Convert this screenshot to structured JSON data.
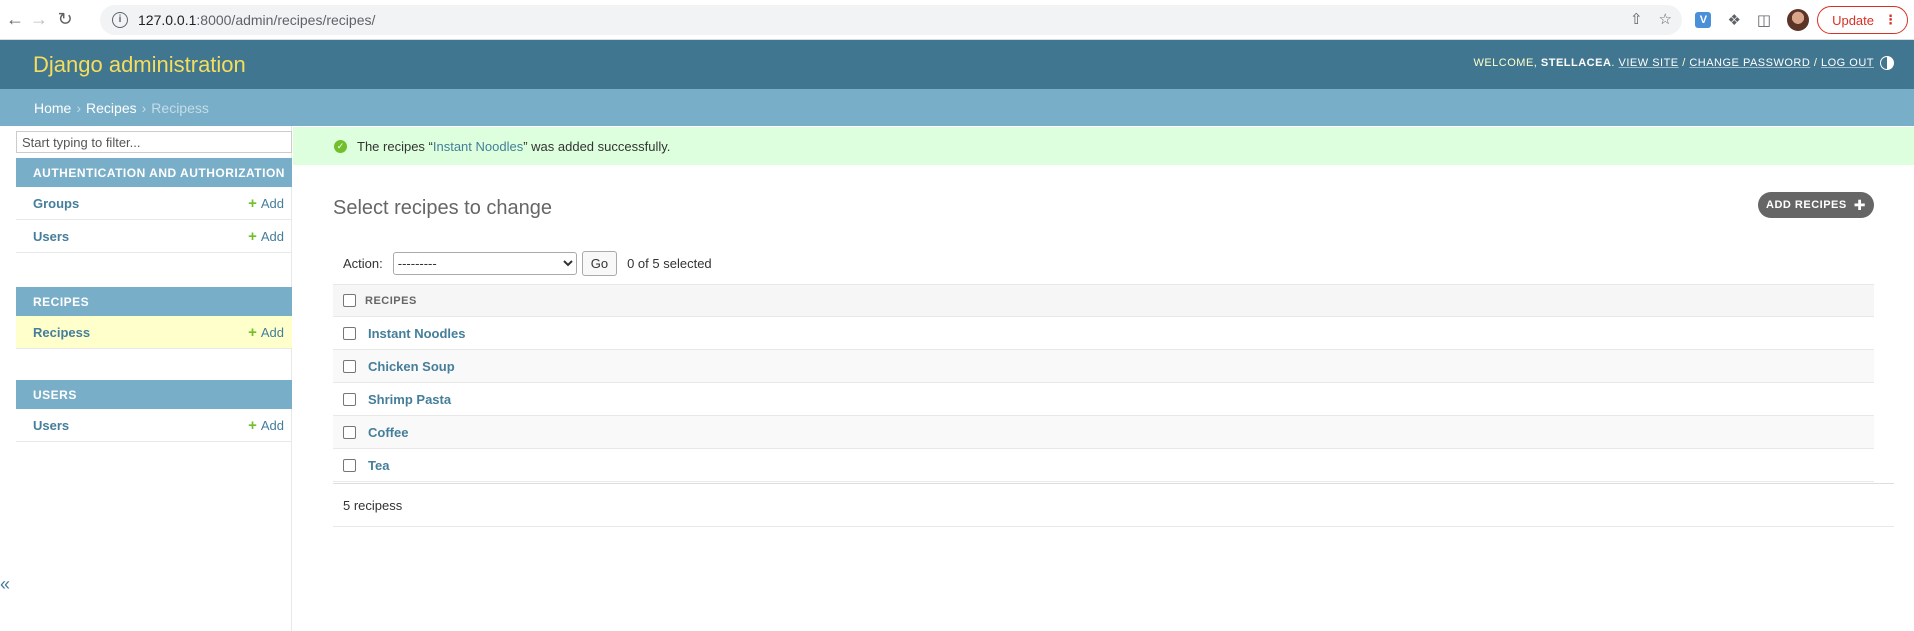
{
  "browser": {
    "url_host": "127.0.0.1",
    "url_path": ":8000/admin/recipes/recipes/",
    "update_label": "Update",
    "extension_label": "V"
  },
  "header": {
    "site_title": "Django administration",
    "welcome": "Welcome,",
    "username": "stellacea",
    "view_site": "View site",
    "change_password": "Change password",
    "log_out": "Log out"
  },
  "breadcrumbs": {
    "home": "Home",
    "app": "Recipes",
    "current": "Recipess",
    "separator": "›"
  },
  "sidebar": {
    "filter_placeholder": "Start typing to filter...",
    "add_label": "Add",
    "apps": [
      {
        "caption": "Authentication and Authorization",
        "models": [
          "Groups",
          "Users"
        ]
      },
      {
        "caption": "Recipes",
        "models": [
          "Recipess"
        ]
      },
      {
        "caption": "Users",
        "models": [
          "Users"
        ]
      }
    ],
    "collapse_glyph": "«"
  },
  "message": {
    "prefix": "The recipes “",
    "link": "Instant Noodles",
    "suffix": "” was added successfully."
  },
  "content": {
    "title": "Select recipes to change",
    "add_button": "Add recipes",
    "action_label": "Action:",
    "action_selected": "---------",
    "go_label": "Go",
    "counter": "0 of 5 selected",
    "column_header": "Recipes",
    "rows": [
      "Instant Noodles",
      "Chicken Soup",
      "Shrimp Pasta",
      "Coffee",
      "Tea"
    ],
    "paginator": "5 recipess"
  },
  "colors": {
    "header_bg": "#417690",
    "breadcrumb_bg": "#79aec8",
    "site_title": "#f5dd5d",
    "link": "#447e9b",
    "success_bg": "#ddffdd",
    "add_green": "#70bf2b"
  }
}
